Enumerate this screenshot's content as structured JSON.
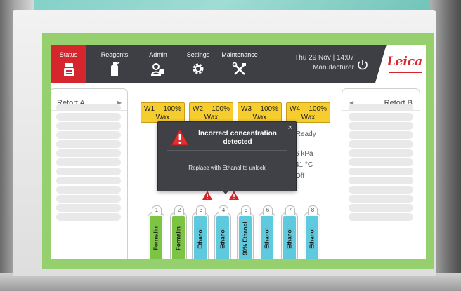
{
  "tabs": [
    {
      "label": "Status",
      "icon": "status-instrument-icon",
      "active": true
    },
    {
      "label": "Reagents",
      "icon": "reagent-bottle-icon",
      "active": false
    },
    {
      "label": "Admin",
      "icon": "admin-users-icon",
      "active": false
    },
    {
      "label": "Settings",
      "icon": "gear-icon",
      "active": false
    },
    {
      "label": "Maintenance",
      "icon": "tools-icon",
      "active": false
    }
  ],
  "header": {
    "datetime": "Thu 29 Nov | 14:07",
    "user": "Manufacturer",
    "logo": "Leica"
  },
  "retort_a": {
    "title": "Retort A"
  },
  "retort_b": {
    "title": "Retort B"
  },
  "wax_baths": [
    {
      "name": "W1",
      "percent": "100%",
      "label": "Wax"
    },
    {
      "name": "W2",
      "percent": "100%",
      "label": "Wax"
    },
    {
      "name": "W3",
      "percent": "100%",
      "label": "Wax"
    },
    {
      "name": "W4",
      "percent": "100%",
      "label": "Wax"
    }
  ],
  "status_readouts": {
    "state": "/Ready",
    "pressure": "6 kPa",
    "temperature": "41 °C",
    "mode": "Off"
  },
  "bottles": [
    {
      "number": "1",
      "reagent": "Formalin",
      "color": "#7cc444",
      "warning": false
    },
    {
      "number": "2",
      "reagent": "Formalin",
      "color": "#7cc444",
      "warning": false
    },
    {
      "number": "3",
      "reagent": "Ethanol",
      "color": "#5fc9de",
      "warning": true
    },
    {
      "number": "4",
      "reagent": "Ethanol",
      "color": "#5fc9de",
      "warning": true
    },
    {
      "number": "5",
      "reagent": "90% Ethanol",
      "color": "#5fc9de",
      "warning": false
    },
    {
      "number": "6",
      "reagent": "Ethanol",
      "color": "#5fc9de",
      "warning": false
    },
    {
      "number": "7",
      "reagent": "Ethanol",
      "color": "#5fc9de",
      "warning": false
    },
    {
      "number": "8",
      "reagent": "Ethanol",
      "color": "#5fc9de",
      "warning": false
    }
  ],
  "dialog": {
    "title": "Incorrect concentration detected",
    "message": "Replace with Ethanol to unlock",
    "close_glyph": "×"
  },
  "colors": {
    "active_tab": "#d4262c",
    "topbar": "#3d3f44",
    "wax": "#f6cd2e",
    "formalin": "#7cc444",
    "ethanol": "#5fc9de",
    "frame_green": "#96cf6e"
  }
}
